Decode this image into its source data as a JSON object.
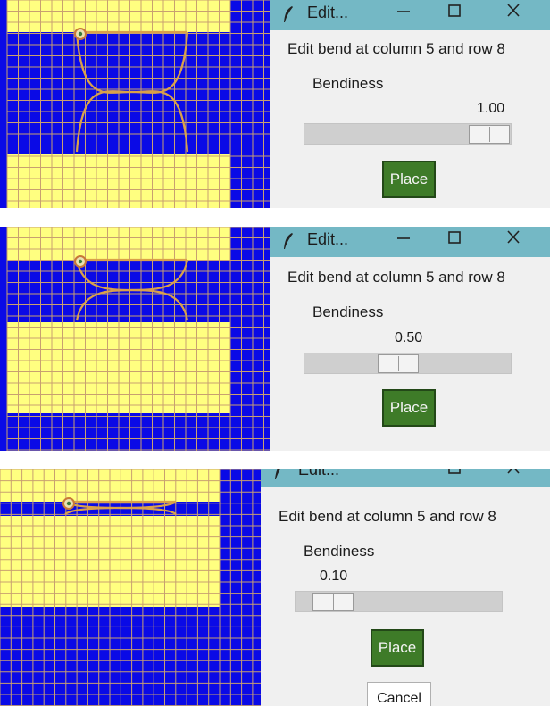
{
  "colors": {
    "board_background": "#0a0ae6",
    "cell_fill": "#ffff80",
    "grid_line": "#c8a070",
    "bend_curve": "#d9a14a",
    "titlebar": "#74b8c5",
    "place_button": "#3e7b28",
    "dialog_background": "#f0f0f0"
  },
  "icons": {
    "window_icon": "feather-icon",
    "minimize": "minimize-icon",
    "maximize": "maximize-icon",
    "close": "close-icon",
    "bend_handle": "bend-handle-icon"
  },
  "panels": [
    {
      "dialog": {
        "title": "Edit...",
        "headline": "Edit bend at column 5 and row 8",
        "slider_label": "Bendiness",
        "value_text": "1.00",
        "bendiness": 1.0,
        "place_label": "Place"
      }
    },
    {
      "dialog": {
        "title": "Edit...",
        "headline": "Edit bend at column 5 and row 8",
        "slider_label": "Bendiness",
        "value_text": "0.50",
        "bendiness": 0.5,
        "place_label": "Place"
      }
    },
    {
      "dialog": {
        "title": "Edit...",
        "headline": "Edit bend at column 5 and row 8",
        "slider_label": "Bendiness",
        "value_text": "0.10",
        "bendiness": 0.1,
        "place_label": "Place",
        "cancel_label": "Cancel"
      }
    }
  ]
}
